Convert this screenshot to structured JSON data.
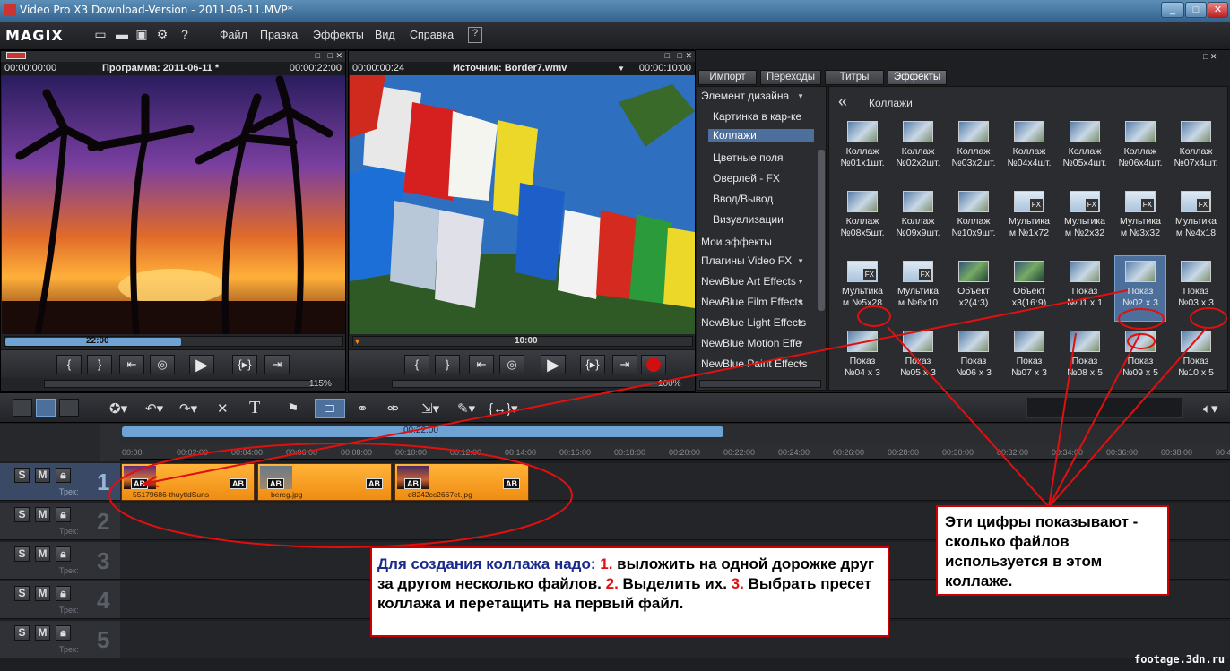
{
  "window": {
    "title": "Video Pro X3 Download-Version - 2011-06-11.MVP*",
    "min": "_",
    "max": "□",
    "close": "✕"
  },
  "app": {
    "logo": "MAGIX"
  },
  "menu": {
    "items": [
      "Файл",
      "Правка",
      "Эффекты",
      "Вид",
      "Справка"
    ]
  },
  "program_monitor": {
    "time_left": "00:00:00:00",
    "title": "Программа: 2011-06-11 *",
    "time_right": "00:00:22:00",
    "scrub_label": "22:00",
    "zoom": "115%"
  },
  "source_monitor": {
    "time_left": "00:00:00:24",
    "title": "Источник: Border7.wmv",
    "time_right": "00:00:10:00",
    "scrub_label": "10:00",
    "zoom": "100%"
  },
  "media_tabs": [
    "Импорт",
    "Переходы",
    "Титры",
    "Эффекты"
  ],
  "categories": [
    {
      "label": "Элемент дизайна",
      "expand": true
    },
    {
      "label": "Картинка в кар-ке",
      "sub": true
    },
    {
      "label": "Коллажи",
      "sub": true,
      "selected": true
    },
    {
      "label": "Цветные поля",
      "sub": true
    },
    {
      "label": "Оверлей - FX",
      "sub": true
    },
    {
      "label": "Ввод/Вывод",
      "sub": true
    },
    {
      "label": "Визуализации",
      "sub": true
    },
    {
      "label": "Мои эффекты"
    },
    {
      "label": "Плагины Video FX",
      "expand": true
    },
    {
      "label": "NewBlue Art Effects",
      "expand": true
    },
    {
      "label": "NewBlue Film Effects",
      "expand": true
    },
    {
      "label": "NewBlue Light Effects",
      "expand": true
    },
    {
      "label": "NewBlue Motion Effe",
      "expand": true
    },
    {
      "label": "NewBlue Paint Effects",
      "expand": true
    }
  ],
  "fx_panel": {
    "back": "«",
    "path": "Коллажи",
    "presets": [
      [
        "Коллаж",
        "№01x1шт."
      ],
      [
        "Коллаж",
        "№02x2шт."
      ],
      [
        "Коллаж",
        "№03x2шт."
      ],
      [
        "Коллаж",
        "№04x4шт."
      ],
      [
        "Коллаж",
        "№05x4шт."
      ],
      [
        "Коллаж",
        "№06x4шт."
      ],
      [
        "Коллаж",
        "№07x4шт."
      ],
      [
        "Коллаж",
        "№08x5шт."
      ],
      [
        "Коллаж",
        "№09x9шт."
      ],
      [
        "Коллаж",
        "№10x9шт."
      ],
      [
        "Мультика",
        "м №1x72"
      ],
      [
        "Мультика",
        "м №2x32"
      ],
      [
        "Мультика",
        "м №3x32"
      ],
      [
        "Мультика",
        "м №4x18"
      ],
      [
        "Мультика",
        "м №5x28"
      ],
      [
        "Мультика",
        "м №6x10"
      ],
      [
        "Объект",
        "x2(4:3)"
      ],
      [
        "Объект",
        "x3(16:9)"
      ],
      [
        "Показ",
        "№01 x 1"
      ],
      [
        "Показ",
        "№02 x 3"
      ],
      [
        "Показ",
        "№03 x 3"
      ],
      [
        "Показ",
        "№04 x 3"
      ],
      [
        "Показ",
        "№05 x 3"
      ],
      [
        "Показ",
        "№06 x 3"
      ],
      [
        "Показ",
        "№07 x 3"
      ],
      [
        "Показ",
        "№08 x 5"
      ],
      [
        "Показ",
        "№09 x 5"
      ],
      [
        "Показ",
        "№10 x 5"
      ]
    ],
    "selected_index": 19
  },
  "timeline": {
    "range_label": "00:22:00",
    "ruler": [
      "00:00",
      "00:02:00",
      "00:04:00",
      "00:06:00",
      "00:08:00",
      "00:10:00",
      "00:12:00",
      "00:14:00",
      "00:16:00",
      "00:18:00",
      "00:20:00",
      "00:22:00",
      "00:24:00",
      "00:26:00",
      "00:28:00",
      "00:30:00",
      "00:32:00",
      "00:34:00",
      "00:36:00",
      "00:38:00",
      "00:40:"
    ],
    "track_buttons": [
      "S",
      "M"
    ],
    "track_label": "Трек:",
    "tracks": [
      "1",
      "2",
      "3",
      "4",
      "5"
    ],
    "clips": [
      {
        "name": "55179686-thuytldSuns"
      },
      {
        "name": "bereg.jpg"
      },
      {
        "name": "d8242cc2667et.jpg"
      }
    ],
    "ab": "AB"
  },
  "annotations": {
    "left": {
      "p1": "Для создания коллажа надо: ",
      "n1": "1.",
      "p2": " выложить на одной дорожке друг за другом несколько файлов. ",
      "n2": "2.",
      "p3": " Выделить их. ",
      "n3": "3.",
      "p4": " Выбрать пресет коллажа и перетащить на первый файл."
    },
    "right": "Эти цифры показывают - сколько файлов используется в этом коллаже."
  },
  "watermark": "footage.3dn.ru"
}
